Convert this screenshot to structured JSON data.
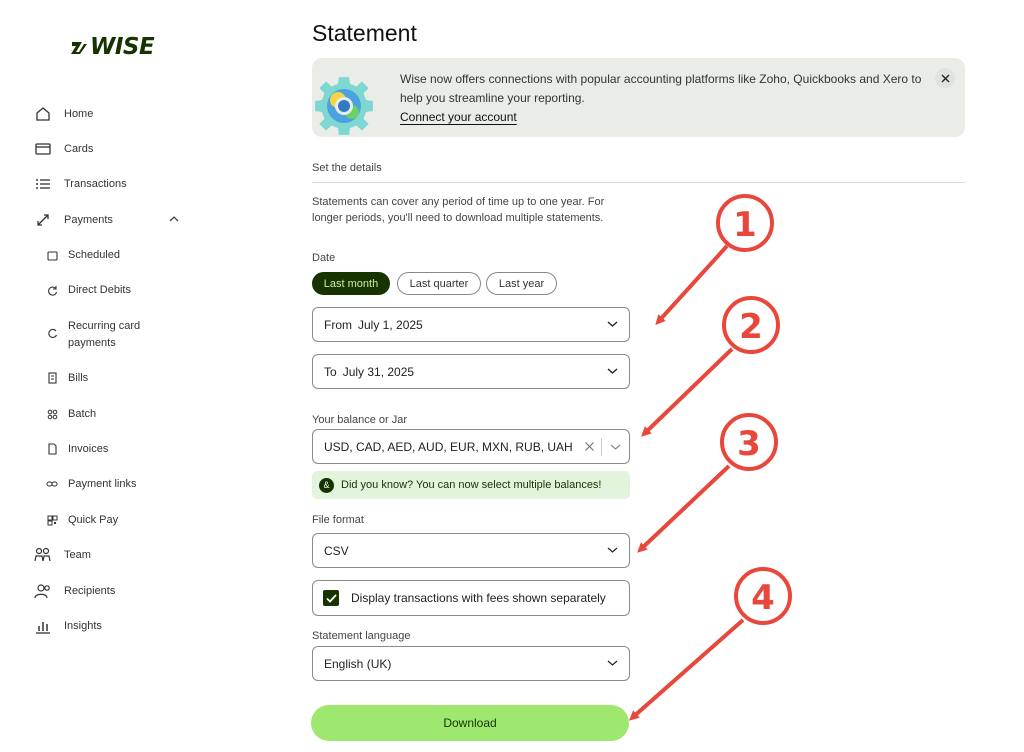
{
  "brand": {
    "name": "WISE",
    "color": "#163300",
    "accent": "#9fe870"
  },
  "sidebar": {
    "items": [
      {
        "label": "Home",
        "icon": "home-icon"
      },
      {
        "label": "Cards",
        "icon": "card-icon"
      },
      {
        "label": "Transactions",
        "icon": "list-icon"
      },
      {
        "label": "Payments",
        "icon": "transfer-icon",
        "expanded": true
      }
    ],
    "payments_sub": [
      {
        "label": "Scheduled",
        "icon": "calendar-icon"
      },
      {
        "label": "Direct Debits",
        "icon": "refresh-icon"
      },
      {
        "label": "Recurring card payments",
        "label_line1": "Recurring card",
        "label_line2": "payments",
        "icon": "repeat-icon"
      },
      {
        "label": "Bills",
        "icon": "bill-icon"
      },
      {
        "label": "Batch",
        "icon": "batch-icon"
      },
      {
        "label": "Invoices",
        "icon": "invoice-icon"
      },
      {
        "label": "Payment links",
        "icon": "link-icon"
      },
      {
        "label": "Quick Pay",
        "icon": "qr-icon"
      }
    ],
    "bottom_items": [
      {
        "label": "Team",
        "icon": "team-icon"
      },
      {
        "label": "Recipients",
        "icon": "recipients-icon"
      },
      {
        "label": "Insights",
        "icon": "chart-icon"
      }
    ]
  },
  "main": {
    "title": "Statement",
    "banner": {
      "text": "Wise now offers connections with popular accounting platforms like Zoho, Quickbooks and Xero to help you streamline your reporting.",
      "link": "Connect your account"
    },
    "section_label": "Set the details",
    "description": "Statements can cover any period of time up to one year. For longer periods, you'll need to download multiple statements.",
    "date": {
      "label": "Date",
      "chips": [
        "Last month",
        "Last quarter",
        "Last year"
      ],
      "active_chip": "Last month",
      "from_prefix": "From",
      "from_value": "July 1, 2025",
      "to_prefix": "To",
      "to_value": "July 31, 2025"
    },
    "balance": {
      "label": "Your balance or Jar",
      "value": "USD, CAD, AED, AUD, EUR, MXN, RUB, UAH",
      "hint": "Did you know? You can now select multiple balances!"
    },
    "file_format": {
      "label": "File format",
      "value": "CSV"
    },
    "fees_checkbox": {
      "label": "Display transactions with fees shown separately",
      "checked": true
    },
    "language": {
      "label": "Statement language",
      "value": "English (UK)"
    },
    "download_label": "Download"
  },
  "annotations": {
    "color": "#e8473b",
    "numbers": [
      "1",
      "2",
      "3",
      "4"
    ]
  }
}
